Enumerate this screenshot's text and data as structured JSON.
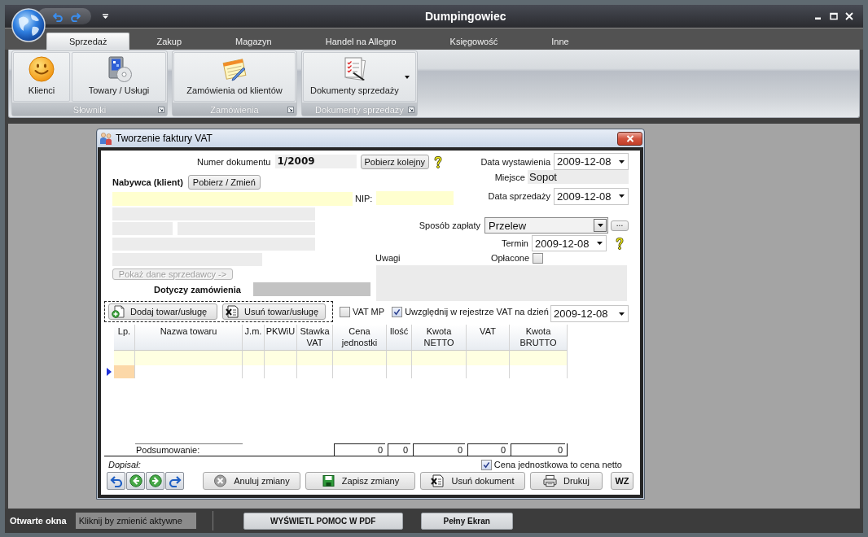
{
  "window": {
    "title": "Dumpingowiec"
  },
  "ribbon": {
    "tabs": [
      {
        "label": "Sprzedaż",
        "selected": true
      },
      {
        "label": "Zakup",
        "selected": false
      },
      {
        "label": "Magazyn",
        "selected": false
      },
      {
        "label": "Handel na Allegro",
        "selected": false
      },
      {
        "label": "Księgowość",
        "selected": false
      },
      {
        "label": "Inne",
        "selected": false
      }
    ],
    "groups": [
      {
        "label": "Słowniki",
        "buttons": [
          {
            "label": "Klienci",
            "dropdown": false
          },
          {
            "label": "Towary / Usługi",
            "dropdown": false
          }
        ]
      },
      {
        "label": "Zamówienia",
        "buttons": [
          {
            "label": "Zamówienia od klientów",
            "dropdown": false
          }
        ]
      },
      {
        "label": "Dokumenty sprzedaży",
        "buttons": [
          {
            "label": "Dokumenty sprzedaży",
            "dropdown": true
          }
        ]
      }
    ]
  },
  "dialog": {
    "title": "Tworzenie faktury VAT",
    "document_number": {
      "label": "Numer dokumentu",
      "value": "1/2009"
    },
    "next_number_button": "Pobierz kolejny",
    "issue_date": {
      "label": "Data wystawienia",
      "value": "2009-12-08"
    },
    "place": {
      "label": "Miejsce",
      "value": "Sopot"
    },
    "buyer": {
      "label": "Nabywca (klient)",
      "button": "Pobierz / Zmień"
    },
    "nip": {
      "label": "NIP:"
    },
    "sale_date": {
      "label": "Data sprzedaży",
      "value": "2009-12-08"
    },
    "payment_method": {
      "label": "Sposób zapłaty",
      "value": "Przelew",
      "button": "..."
    },
    "due_date": {
      "label": "Termin",
      "value": "2009-12-08"
    },
    "notes": {
      "label": "Uwagi"
    },
    "paid": {
      "label": "Opłacone",
      "checked": false
    },
    "show_seller_button": {
      "label": "Pokaż dane sprzedawcy ->",
      "disabled": true
    },
    "order": {
      "label": "Dotyczy zamówienia"
    },
    "item_buttons": [
      "Dodaj towar/usługę",
      "Usuń towar/usługę"
    ],
    "vat_mp": {
      "label": "VAT MP",
      "checked": false
    },
    "vat_register": {
      "label": "Uwzględnij w rejestrze VAT na dzień",
      "checked": true,
      "date": "2009-12-08"
    },
    "table": {
      "columns": [
        "Lp.",
        "Nazwa towaru",
        "J.m.",
        "PKWiU",
        "Stawka VAT",
        "Cena jednostki",
        "Ilość",
        "Kwota NETTO",
        "VAT",
        "Kwota BRUTTO"
      ],
      "rows": [
        {
          "kind": "item",
          "current": false
        },
        {
          "kind": "new",
          "current": true
        }
      ],
      "summary": {
        "label": "Podsumowanie:",
        "totals": [
          "0",
          "0",
          "0",
          "0",
          "0"
        ]
      }
    },
    "added_by": {
      "label": "Dopisał:"
    },
    "net_price": {
      "label": "Cena jednostkowa to cena netto",
      "checked": true
    },
    "buttons": [
      "Anuluj zmiany",
      "Zapisz zmiany",
      "Usuń dokument",
      "Drukuj",
      "WZ"
    ]
  },
  "bottom_bar": {
    "label": "Otwarte okna",
    "hint": "Kliknij by zmienić aktywne",
    "buttons": [
      "WYŚWIETL POMOC W PDF",
      "Pełny Ekran"
    ]
  }
}
